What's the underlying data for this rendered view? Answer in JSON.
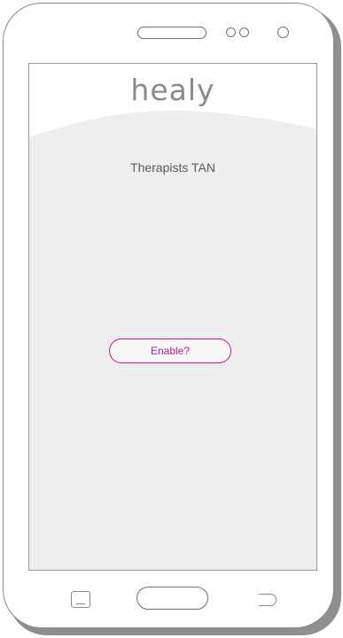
{
  "app": {
    "logo_text": "healy",
    "title": "Therapists TAN"
  },
  "actions": {
    "enable_label": "Enable?"
  },
  "colors": {
    "accent": "#c2188f",
    "screen_background": "#eeeeee",
    "header_background": "#ffffff",
    "logo": "#8a8a8a",
    "text": "#5a5a5a"
  },
  "hardware": {
    "top_icons": [
      "speaker-icon",
      "sensor-icon",
      "sensor-icon",
      "front-camera-icon"
    ],
    "bottom_icons": [
      "recent-apps-icon",
      "home-button",
      "back-icon"
    ]
  }
}
